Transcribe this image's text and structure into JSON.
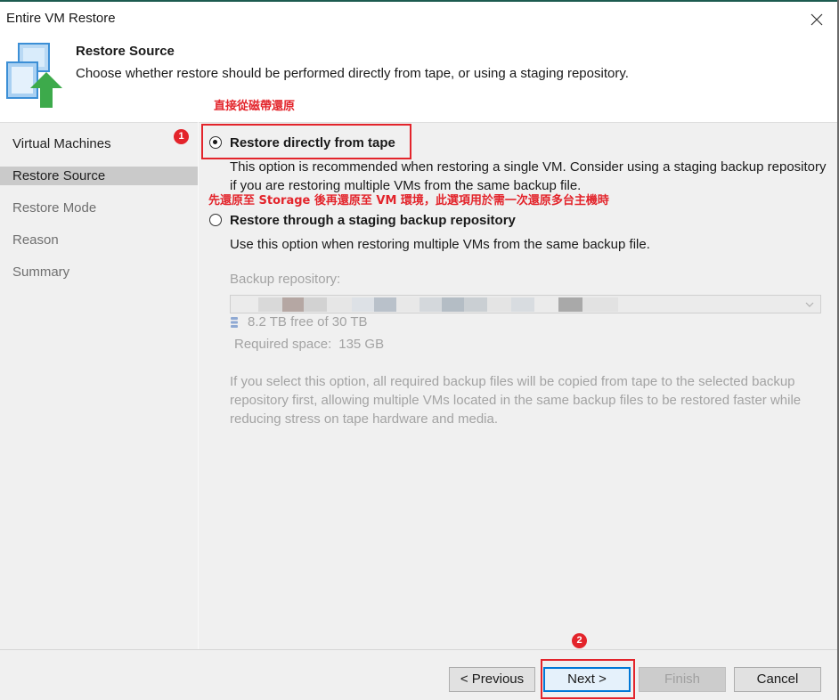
{
  "window": {
    "title": "Entire VM Restore"
  },
  "header": {
    "title": "Restore Source",
    "subtitle": "Choose whether restore should be performed directly from tape, or using a staging repository."
  },
  "sidebar": {
    "items": [
      {
        "label": "Virtual Machines",
        "selected": false,
        "muted": false
      },
      {
        "label": "Restore Source",
        "selected": true,
        "muted": false
      },
      {
        "label": "Restore Mode",
        "selected": false,
        "muted": true
      },
      {
        "label": "Reason",
        "selected": false,
        "muted": true
      },
      {
        "label": "Summary",
        "selected": false,
        "muted": true
      }
    ]
  },
  "annotations": {
    "badge_1": "1",
    "badge_2": "2",
    "note_tape": "直接從磁帶還原",
    "note_staging": "先還原至 Storage 後再還原至 VM 環境，此選項用於需一次還原多台主機時"
  },
  "options": [
    {
      "label": "Restore directly from tape",
      "description": "This option is recommended when restoring a single VM. Consider using a staging backup repository if you are restoring multiple VMs from the same backup file.",
      "checked": true
    },
    {
      "label": "Restore through a staging backup repository",
      "description": "Use this option when restoring multiple VMs from the same backup file.",
      "checked": false
    }
  ],
  "repository": {
    "label": "Backup repository:",
    "free_space": "8.2 TB free of 30 TB",
    "required_label": "Required space:",
    "required_value": "135 GB",
    "note": "If you select this option, all required backup files will be copied from tape to the selected backup repository first, allowing multiple VMs located in the same backup files to be restored faster while reducing stress on tape hardware and media.",
    "enabled": false
  },
  "footer": {
    "previous": "< Previous",
    "next": "Next >",
    "finish": "Finish",
    "cancel": "Cancel",
    "finish_enabled": false
  },
  "icons": {
    "app": "vm-restore-icon",
    "close": "close-icon",
    "dropdown": "chevron-down-icon",
    "storage": "database-icon",
    "radio": "radio-button-icon"
  },
  "colors": {
    "annotation_red": "#e3242b",
    "accent_blue": "#0078d7",
    "title_bar_accent": "#1c5b50",
    "disabled_text": "#a3a3a3",
    "panel_bg": "#f0f0f0",
    "selected_bg": "#cacaca"
  }
}
